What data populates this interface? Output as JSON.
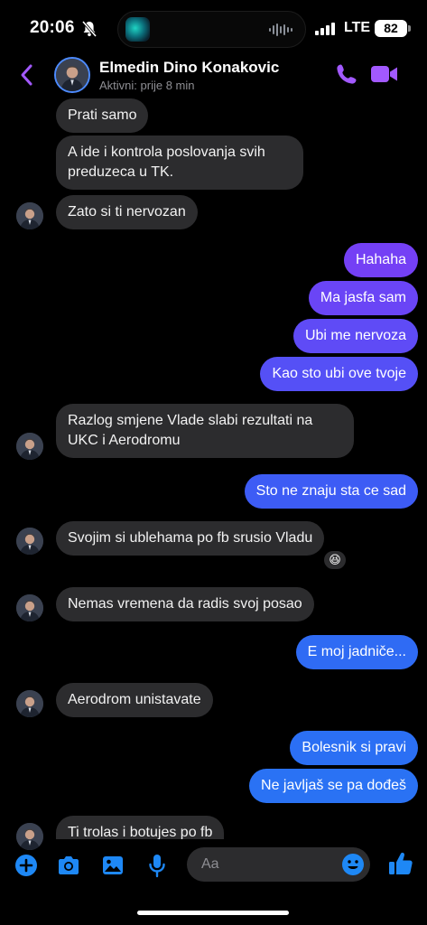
{
  "status_bar": {
    "time": "20:06",
    "network": "LTE",
    "battery": "82"
  },
  "header": {
    "name": "Elmedin Dino Konakovic",
    "status": "Aktivni: prije 8 min"
  },
  "colors": {
    "accent": "#a259ff",
    "outgoing_blue": "#2f6bf4",
    "outgoing_purple": "#7440f5",
    "incoming": "#2c2c2e"
  },
  "messages": [
    {
      "from": "them",
      "text": "Prati samo"
    },
    {
      "from": "them",
      "text": "A ide i kontrola poslovanja svih preduzeca u TK."
    },
    {
      "from": "them",
      "text": "Zato si ti nervozan"
    },
    {
      "from": "me",
      "text": "Hahaha"
    },
    {
      "from": "me",
      "text": "Ma jasfa sam"
    },
    {
      "from": "me",
      "text": "Ubi me nervoza"
    },
    {
      "from": "me",
      "text": "Kao sto ubi ove tvoje"
    },
    {
      "from": "them",
      "text": "Razlog smjene Vlade slabi rezultati na UKC i Aerodromu"
    },
    {
      "from": "me",
      "text": "Sto ne znaju sta ce sad"
    },
    {
      "from": "them",
      "text": "Svojim si ublehama po fb srusio Vladu",
      "reaction": "😆"
    },
    {
      "from": "them",
      "text": "Nemas vremena da radis svoj posao"
    },
    {
      "from": "me",
      "text": "E moj jadniče..."
    },
    {
      "from": "them",
      "text": "Aerodrom unistavate"
    },
    {
      "from": "me",
      "text": "Bolesnik si pravi"
    },
    {
      "from": "me",
      "text": "Ne javljaš se pa dođeš"
    },
    {
      "from": "them",
      "text": "Ti trolas i botujes po fb"
    }
  ],
  "composer": {
    "placeholder": "Aa",
    "icons": [
      "plus-circle-icon",
      "camera-icon",
      "image-icon",
      "microphone-icon",
      "emoji-icon",
      "thumbs-up-icon"
    ]
  }
}
